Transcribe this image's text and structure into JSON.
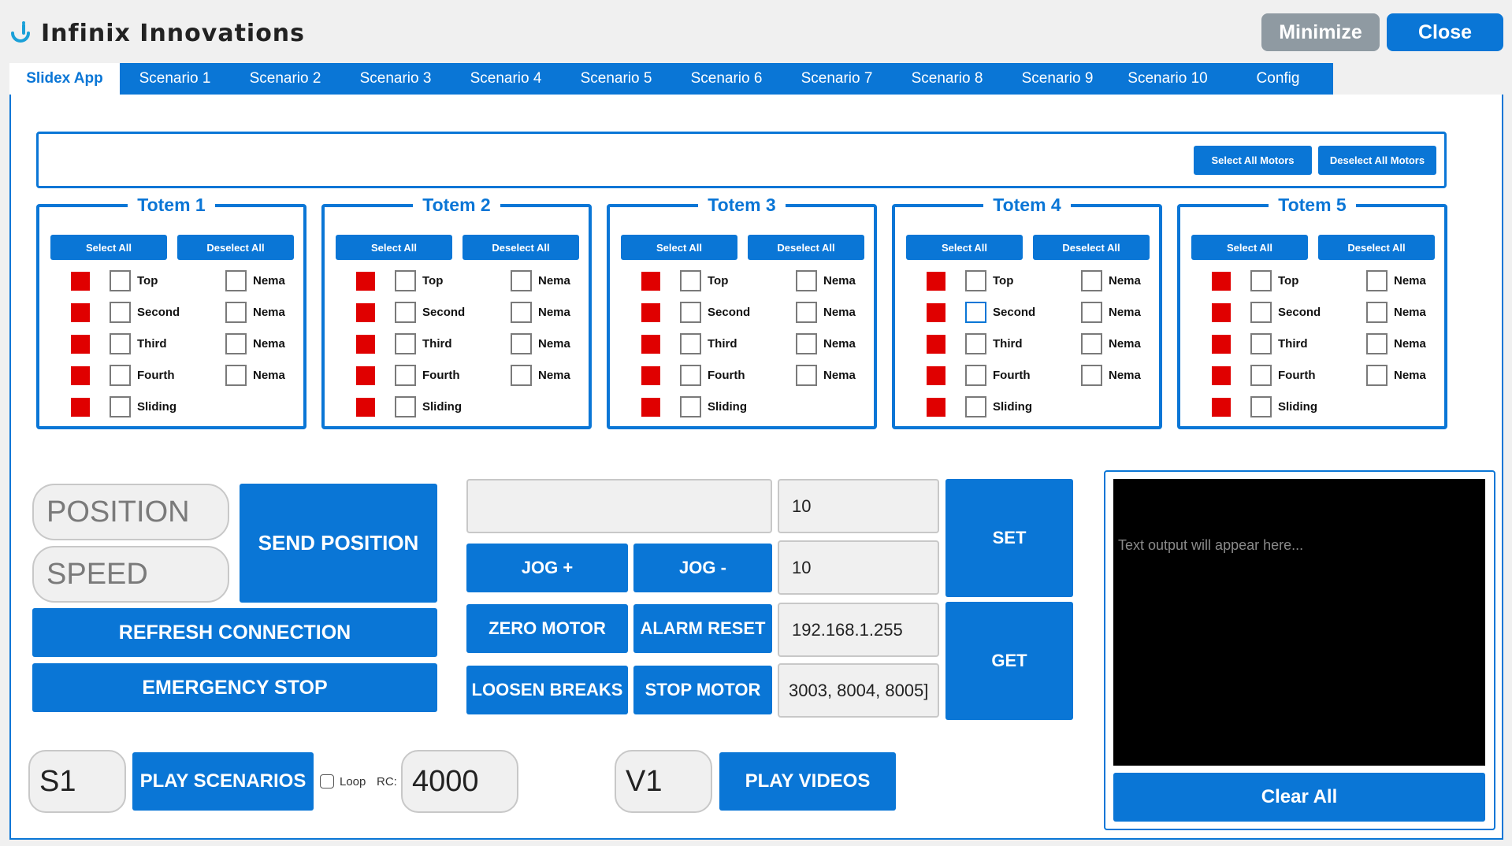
{
  "app": {
    "title": "Infinix Innovations",
    "minimize": "Minimize",
    "close": "Close"
  },
  "tabs": [
    "Slidex App",
    "Scenario 1",
    "Scenario 2",
    "Scenario 3",
    "Scenario 4",
    "Scenario 5",
    "Scenario 6",
    "Scenario 7",
    "Scenario 8",
    "Scenario 9",
    "Scenario 10",
    "Config"
  ],
  "motors": {
    "select_all": "Select All Motors",
    "deselect_all": "Deselect All Motors"
  },
  "totem_buttons": {
    "select_all": "Select All",
    "deselect_all": "Deselect All"
  },
  "totems": [
    {
      "title": "Totem 1",
      "left": [
        "Top",
        "Second",
        "Third",
        "Fourth",
        "Sliding"
      ],
      "right": [
        "Nema",
        "Nema",
        "Nema",
        "Nema"
      ]
    },
    {
      "title": "Totem 2",
      "left": [
        "Top",
        "Second",
        "Third",
        "Fourth",
        "Sliding"
      ],
      "right": [
        "Nema",
        "Nema",
        "Nema",
        "Nema"
      ]
    },
    {
      "title": "Totem 3",
      "left": [
        "Top",
        "Second",
        "Third",
        "Fourth",
        "Sliding"
      ],
      "right": [
        "Nema",
        "Nema",
        "Nema",
        "Nema"
      ]
    },
    {
      "title": "Totem 4",
      "left": [
        "Top",
        "Second",
        "Third",
        "Fourth",
        "Sliding"
      ],
      "right": [
        "Nema",
        "Nema",
        "Nema",
        "Nema"
      ]
    },
    {
      "title": "Totem 5",
      "left": [
        "Top",
        "Second",
        "Third",
        "Fourth",
        "Sliding"
      ],
      "right": [
        "Nema",
        "Nema",
        "Nema",
        "Nema"
      ]
    }
  ],
  "controls": {
    "position_placeholder": "POSITION",
    "speed_placeholder": "SPEED",
    "send_position": "SEND POSITION",
    "refresh": "REFRESH CONNECTION",
    "emergency": "EMERGENCY STOP",
    "jog_plus": "JOG +",
    "jog_minus": "JOG -",
    "zero_motor": "ZERO MOTOR",
    "alarm_reset": "ALARM RESET",
    "loosen_breaks": "LOOSEN BREAKS",
    "stop_motor": "STOP MOTOR",
    "field1": "10",
    "field2": "10",
    "ip": "192.168.1.255",
    "ports": "3003, 8004, 8005]",
    "set": "SET",
    "get": "GET"
  },
  "playback": {
    "scenario_value": "S1",
    "play_scenarios": "PLAY SCENARIOS",
    "loop_label": "Loop",
    "rc_label": "RC:",
    "rc_value": "4000",
    "video_value": "V1",
    "play_videos": "PLAY VIDEOS"
  },
  "output": {
    "placeholder": "Text output will appear here...",
    "clear": "Clear All"
  }
}
